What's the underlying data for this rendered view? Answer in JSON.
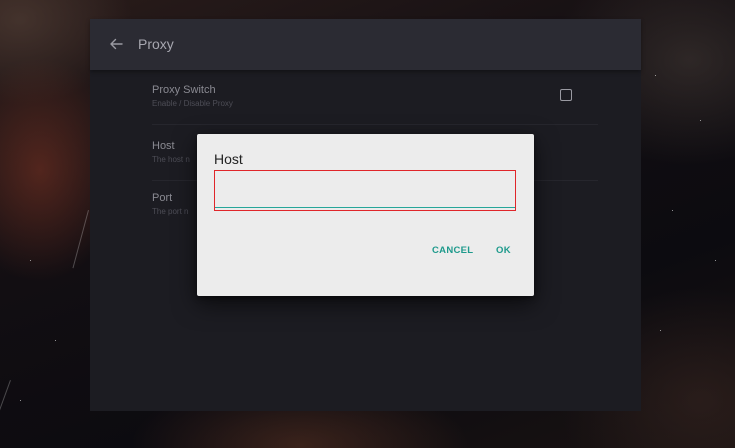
{
  "toolbar": {
    "title": "Proxy",
    "back_icon": "arrow-left-icon"
  },
  "preferences": [
    {
      "title": "Proxy Switch",
      "summary": "Enable / Disable Proxy",
      "checked": false
    },
    {
      "title": "Host",
      "summary": "The host n"
    },
    {
      "title": "Port",
      "summary": "The port n"
    }
  ],
  "dialog": {
    "title": "Host",
    "input_value": "",
    "cancel_label": "CANCEL",
    "ok_label": "OK"
  },
  "colors": {
    "accent": "#26a69a",
    "highlight": "#e0262a",
    "dialog_background": "#ececec",
    "panel_background": "#1c1c22",
    "toolbar_background": "#2b2b33"
  }
}
